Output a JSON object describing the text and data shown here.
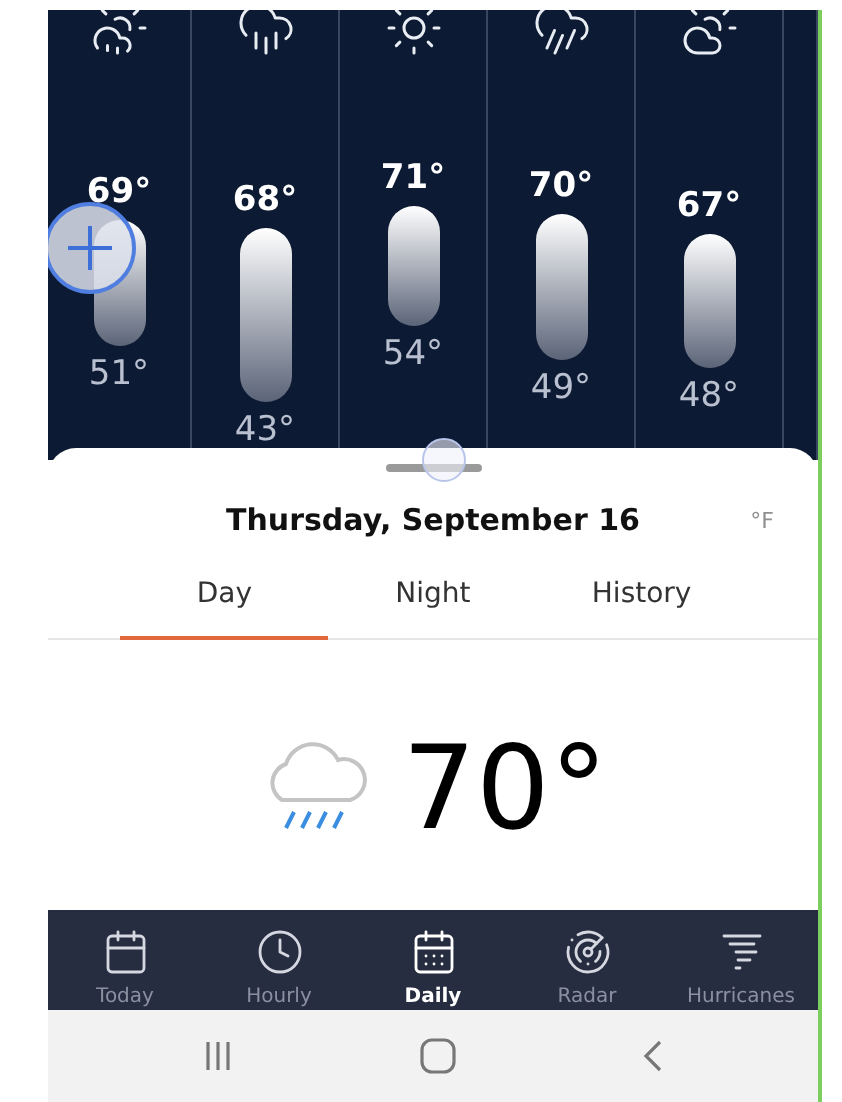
{
  "forecast": {
    "columns": [
      {
        "kind": "sun-cloud-rain",
        "high": "69°",
        "low": "51°"
      },
      {
        "kind": "cloud-rain",
        "high": "68°",
        "low": "43°"
      },
      {
        "kind": "sun",
        "high": "71°",
        "low": "54°"
      },
      {
        "kind": "cloud-heavy-rain",
        "high": "70°",
        "low": "49°"
      },
      {
        "kind": "sun-cloud",
        "high": "67°",
        "low": "48°"
      }
    ]
  },
  "sheet": {
    "title": "Thursday, September 16",
    "unit": "°F",
    "tabs": [
      {
        "label": "Day",
        "selected": true
      },
      {
        "label": "Night",
        "selected": false
      },
      {
        "label": "History",
        "selected": false
      }
    ],
    "current": {
      "temperature": "70°"
    }
  },
  "nav": [
    {
      "label": "Today",
      "kind": "today",
      "selected": false
    },
    {
      "label": "Hourly",
      "kind": "hourly",
      "selected": false
    },
    {
      "label": "Daily",
      "kind": "daily",
      "selected": true
    },
    {
      "label": "Radar",
      "kind": "radar",
      "selected": false
    },
    {
      "label": "Hurricanes",
      "kind": "hurricanes",
      "selected": false
    }
  ]
}
